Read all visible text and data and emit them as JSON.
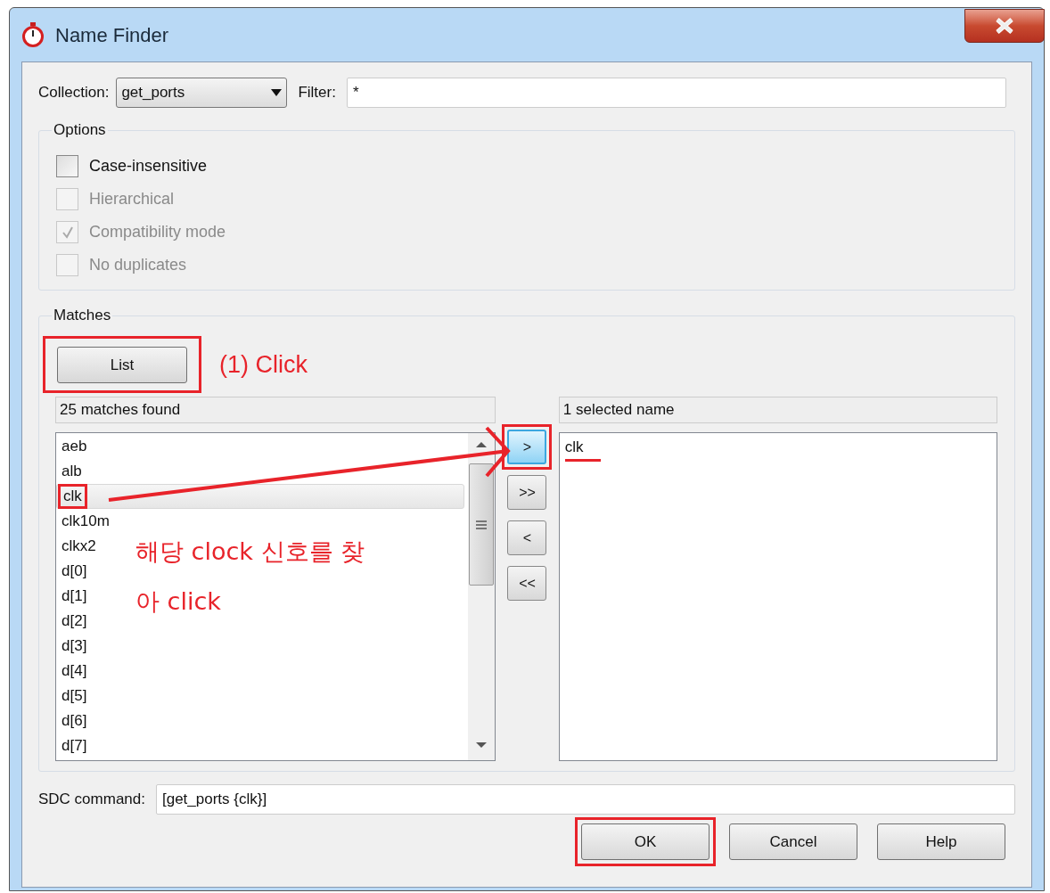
{
  "window": {
    "title": "Name Finder"
  },
  "collection": {
    "label": "Collection:",
    "value": "get_ports"
  },
  "filter": {
    "label": "Filter:",
    "value": "*"
  },
  "options": {
    "title": "Options",
    "items": [
      {
        "label": "Case-insensitive",
        "checked": false,
        "disabled": false
      },
      {
        "label": "Hierarchical",
        "checked": false,
        "disabled": true
      },
      {
        "label": "Compatibility mode",
        "checked": true,
        "disabled": true
      },
      {
        "label": "No duplicates",
        "checked": false,
        "disabled": true
      }
    ]
  },
  "matches": {
    "title": "Matches",
    "list_button": {
      "label": "List",
      "highlighted": true
    },
    "found": "25 matches found",
    "items": [
      {
        "label": "aeb",
        "selected": false,
        "highlighted": false
      },
      {
        "label": "alb",
        "selected": false,
        "highlighted": false
      },
      {
        "label": "clk",
        "selected": true,
        "highlighted": true
      },
      {
        "label": "clk10m",
        "selected": false,
        "highlighted": false
      },
      {
        "label": "clkx2",
        "selected": false,
        "highlighted": false
      },
      {
        "label": "d[0]",
        "selected": false,
        "highlighted": false
      },
      {
        "label": "d[1]",
        "selected": false,
        "highlighted": false
      },
      {
        "label": "d[2]",
        "selected": false,
        "highlighted": false
      },
      {
        "label": "d[3]",
        "selected": false,
        "highlighted": false
      },
      {
        "label": "d[4]",
        "selected": false,
        "highlighted": false
      },
      {
        "label": "d[5]",
        "selected": false,
        "highlighted": false
      },
      {
        "label": "d[6]",
        "selected": false,
        "highlighted": false
      },
      {
        "label": "d[7]",
        "selected": false,
        "highlighted": false
      }
    ],
    "transfer_buttons": [
      {
        "label": ">",
        "focused": true,
        "highlighted": true
      },
      {
        "label": ">>",
        "focused": false,
        "highlighted": false
      },
      {
        "label": "<",
        "focused": false,
        "highlighted": false
      },
      {
        "label": "<<",
        "focused": false,
        "highlighted": false
      }
    ],
    "selected_header": "1 selected name",
    "selected_items": [
      {
        "label": "clk",
        "underlined": true
      }
    ]
  },
  "sdc": {
    "label": "SDC command:",
    "value": "[get_ports {clk}]"
  },
  "buttons": [
    {
      "label": "OK",
      "highlighted": true
    },
    {
      "label": "Cancel",
      "highlighted": false
    },
    {
      "label": "Help",
      "highlighted": false
    }
  ],
  "annotations": [
    {
      "kind": "step",
      "text": "(1) Click"
    },
    {
      "kind": "note",
      "text": "해당 clock 신호를 찾"
    },
    {
      "kind": "note",
      "text": "아 click"
    }
  ]
}
